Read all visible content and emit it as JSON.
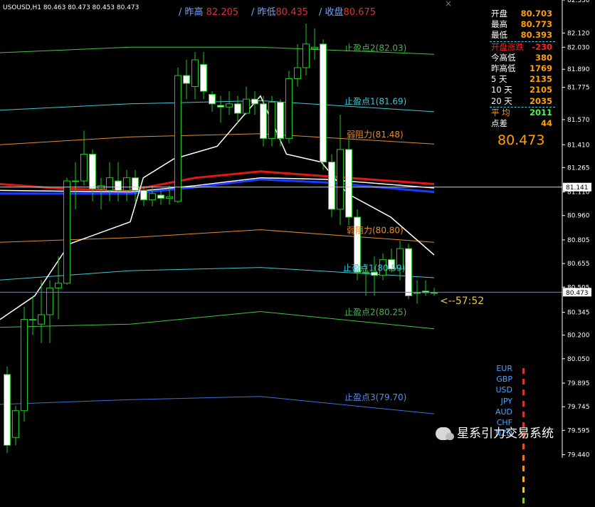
{
  "header": {
    "title": "USOUSD,H1  80.463 80.473 80.453 80.473",
    "prev_high_label": "/ 昨高",
    "prev_high_value": "82.205",
    "prev_low_label": "/ 昨低",
    "prev_low_value": "80.435",
    "prev_close_label": "/ 收盘",
    "prev_close_value": "80.675",
    "close_x": "×"
  },
  "panel": [
    {
      "k": "开盘",
      "v": "80.703",
      "kc": "#ffffff",
      "vc": "#ffa000"
    },
    {
      "k": "最高",
      "v": "80.773",
      "kc": "#ffffff",
      "vc": "#ffa000"
    },
    {
      "k": "最低",
      "v": "80.393",
      "kc": "#ffffff",
      "vc": "#ffa000"
    },
    {
      "k": "开盘涨跌",
      "v": "-230",
      "kc": "#ff2020",
      "vc": "#ff2020"
    },
    {
      "k": "今高低",
      "v": "380",
      "kc": "#ffffff",
      "vc": "#ffa000"
    },
    {
      "k": "昨高低",
      "v": "1769",
      "kc": "#ffffff",
      "vc": "#ffa000"
    },
    {
      "k": "5  天",
      "v": "2135",
      "kc": "#ffffff",
      "vc": "#ffa000"
    },
    {
      "k": "10  天",
      "v": "2105",
      "kc": "#ffffff",
      "vc": "#ffa000"
    },
    {
      "k": "20  天",
      "v": "2035",
      "kc": "#ffffff",
      "vc": "#ffa000"
    },
    {
      "k": "平  均",
      "v": "2011",
      "kc": "#ffa000",
      "vc": "#40ff40"
    },
    {
      "k": "点差",
      "v": "44",
      "kc": "#ffffff",
      "vc": "#ffa000"
    }
  ],
  "current_price_big": "80.473",
  "timer": "<--57:52",
  "currencies": [
    {
      "name": "EUR",
      "levels": 8
    },
    {
      "name": "GBP",
      "levels": 8
    },
    {
      "name": "USD",
      "levels": 3
    },
    {
      "name": "JPY",
      "levels": 6
    },
    {
      "name": "AUD",
      "levels": 6
    },
    {
      "name": "CHF",
      "levels": 8
    },
    {
      "name": "NZD",
      "levels": 6
    }
  ],
  "watermark": "星系引力交易系统",
  "chart_data": {
    "type": "candlestick",
    "symbol": "USOUSD",
    "timeframe": "H1",
    "ylim": [
      79.42,
      82.33
    ],
    "y_ticks": [
      "82.330",
      "82.120",
      "82.030",
      "81.890",
      "81.775",
      "81.570",
      "81.410",
      "81.265",
      "81.110",
      "80.960",
      "80.805",
      "80.655",
      "80.505",
      "80.345",
      "80.200",
      "80.050",
      "79.895",
      "79.745",
      "79.595",
      "79.440"
    ],
    "y_tick_values": [
      82.33,
      82.12,
      82.03,
      81.89,
      81.775,
      81.57,
      81.41,
      81.265,
      81.11,
      80.96,
      80.805,
      80.655,
      80.505,
      80.345,
      80.2,
      80.05,
      79.895,
      79.745,
      79.595,
      79.44
    ],
    "last_price": 80.473,
    "hline_price": 81.141,
    "candles": [
      [
        79.95,
        79.5,
        80.0,
        79.45
      ],
      [
        79.55,
        79.72,
        79.75,
        79.5
      ],
      [
        79.72,
        80.3,
        80.38,
        79.65
      ],
      [
        80.3,
        80.3,
        80.45,
        80.2
      ],
      [
        80.27,
        80.33,
        80.55,
        80.15
      ],
      [
        80.33,
        80.5,
        80.55,
        80.15
      ],
      [
        80.5,
        80.53,
        80.7,
        80.3
      ],
      [
        80.53,
        81.18,
        81.2,
        80.52
      ],
      [
        81.18,
        81.18,
        81.3,
        81.0
      ],
      [
        81.18,
        81.35,
        81.5,
        81.15
      ],
      [
        81.35,
        81.13,
        81.38,
        81.05
      ],
      [
        81.13,
        81.15,
        81.2,
        81.0
      ],
      [
        81.12,
        81.2,
        81.3,
        81.05
      ],
      [
        81.18,
        81.12,
        81.3,
        81.05
      ],
      [
        81.12,
        81.2,
        81.25,
        81.05
      ],
      [
        81.2,
        81.12,
        81.25,
        81.05
      ],
      [
        81.12,
        81.06,
        81.15,
        81.02
      ],
      [
        81.06,
        81.1,
        81.15,
        81.02
      ],
      [
        81.09,
        81.07,
        81.12,
        81.03
      ],
      [
        81.07,
        81.08,
        81.15,
        81.03
      ],
      [
        81.05,
        81.85,
        81.9,
        81.04
      ],
      [
        81.85,
        81.8,
        81.95,
        81.7
      ],
      [
        81.78,
        81.95,
        82.0,
        81.7
      ],
      [
        81.92,
        81.75,
        82.0,
        81.7
      ],
      [
        81.73,
        81.67,
        81.75,
        81.62
      ],
      [
        81.66,
        81.65,
        81.72,
        81.55
      ],
      [
        81.65,
        81.67,
        81.75,
        81.6
      ],
      [
        81.67,
        81.61,
        81.72,
        81.55
      ],
      [
        81.61,
        81.7,
        81.78,
        81.6
      ],
      [
        81.7,
        81.67,
        81.75,
        81.6
      ],
      [
        81.67,
        81.45,
        81.72,
        81.4
      ],
      [
        81.45,
        81.68,
        81.72,
        81.4
      ],
      [
        81.68,
        81.45,
        81.7,
        81.4
      ],
      [
        81.45,
        81.83,
        81.88,
        81.42
      ],
      [
        81.83,
        81.9,
        82.05,
        81.78
      ],
      [
        81.9,
        82.05,
        82.18,
        81.85
      ],
      [
        82.02,
        82.03,
        82.15,
        81.95
      ],
      [
        82.05,
        81.3,
        82.08,
        81.25
      ],
      [
        81.3,
        81.0,
        81.35,
        80.95
      ],
      [
        81.0,
        81.38,
        81.6,
        80.9
      ],
      [
        81.38,
        80.95,
        81.45,
        80.9
      ],
      [
        80.95,
        80.6,
        81.0,
        80.55
      ],
      [
        80.6,
        80.6,
        80.65,
        80.45
      ],
      [
        80.6,
        80.58,
        80.7,
        80.45
      ],
      [
        80.58,
        80.68,
        80.72,
        80.55
      ],
      [
        80.68,
        80.62,
        80.75,
        80.6
      ],
      [
        80.62,
        80.75,
        80.8,
        80.55
      ],
      [
        80.75,
        80.45,
        80.78,
        80.43
      ],
      [
        80.47,
        80.47,
        80.55,
        80.4
      ],
      [
        80.48,
        80.47,
        80.55,
        80.45
      ],
      [
        80.47,
        80.47,
        80.5,
        80.45
      ]
    ],
    "lines": [
      {
        "name": "止盈点2(82.03)",
        "color": "#3cc83c",
        "label_color": "#4caf50",
        "points": [
          [
            0,
            81.995
          ],
          [
            0.3,
            82.03
          ],
          [
            0.6,
            82.03
          ],
          [
            1,
            81.985
          ]
        ]
      },
      {
        "name": "止盈点1(81.69)",
        "color": "#40c8d8",
        "label_color": "#35c8d8",
        "points": [
          [
            0,
            81.63
          ],
          [
            0.3,
            81.67
          ],
          [
            0.6,
            81.69
          ],
          [
            1,
            81.62
          ]
        ]
      },
      {
        "name": "弱阻力(81.48)",
        "color": "#e58c2e",
        "label_color": "#e58c2e",
        "points": [
          [
            0,
            81.41
          ],
          [
            0.3,
            81.46
          ],
          [
            0.6,
            81.48
          ],
          [
            1,
            81.415
          ]
        ]
      },
      {
        "name": "弱阻力(80.80)",
        "color": "#e58c2e",
        "label_color": "#e58c2e",
        "points": [
          [
            0,
            80.79
          ],
          [
            0.3,
            80.82
          ],
          [
            0.6,
            80.87
          ],
          [
            1,
            80.79
          ]
        ]
      },
      {
        "name": "止盈点1(80.59)",
        "color": "#40c8d8",
        "label_color": "#35c8d8",
        "points": [
          [
            0,
            80.55
          ],
          [
            0.3,
            80.61
          ],
          [
            0.6,
            80.63
          ],
          [
            1,
            80.565
          ]
        ]
      },
      {
        "name": "止盈点2(80.25)",
        "color": "#3cc83c",
        "label_color": "#4caf50",
        "points": [
          [
            0,
            80.25
          ],
          [
            0.3,
            80.27
          ],
          [
            0.6,
            80.35
          ],
          [
            1,
            80.24
          ]
        ]
      },
      {
        "name": "止盈点3(79.70)",
        "color": "#3b6fd8",
        "label_color": "#5a8af0",
        "points": [
          [
            0,
            79.76
          ],
          [
            0.3,
            79.79
          ],
          [
            0.6,
            79.81
          ],
          [
            1,
            79.7
          ]
        ]
      }
    ],
    "ma_red": [
      [
        0,
        81.16
      ],
      [
        0.15,
        81.13
      ],
      [
        0.3,
        81.12
      ],
      [
        0.45,
        81.2
      ],
      [
        0.6,
        81.24
      ],
      [
        0.75,
        81.21
      ],
      [
        1,
        81.16
      ]
    ],
    "ma_white": [
      [
        0,
        81.12
      ],
      [
        0.3,
        81.11
      ],
      [
        0.45,
        81.15
      ],
      [
        0.6,
        81.2
      ],
      [
        0.75,
        81.19
      ],
      [
        1,
        81.135
      ]
    ],
    "ma_blue": [
      [
        0,
        81.1
      ],
      [
        0.3,
        81.1
      ],
      [
        0.45,
        81.14
      ],
      [
        0.6,
        81.19
      ],
      [
        0.75,
        81.17
      ],
      [
        1,
        81.11
      ]
    ],
    "ma_fast": [
      [
        0,
        80.3
      ],
      [
        0.08,
        80.45
      ],
      [
        0.16,
        80.78
      ],
      [
        0.3,
        80.92
      ],
      [
        0.33,
        81.2
      ],
      [
        0.4,
        81.32
      ],
      [
        0.5,
        81.4
      ],
      [
        0.6,
        81.72
      ],
      [
        0.66,
        81.35
      ],
      [
        0.74,
        81.3
      ],
      [
        0.8,
        81.1
      ],
      [
        0.9,
        80.95
      ],
      [
        1,
        80.71
      ]
    ],
    "line_labels": [
      "止盈点2(82.03)",
      "止盈点1(81.69)",
      "弱阻力(81.48)",
      "弱阻力(80.80)",
      "止盈点1(80.59)",
      "止盈点2(80.25)",
      "止盈点3(79.70)"
    ]
  }
}
